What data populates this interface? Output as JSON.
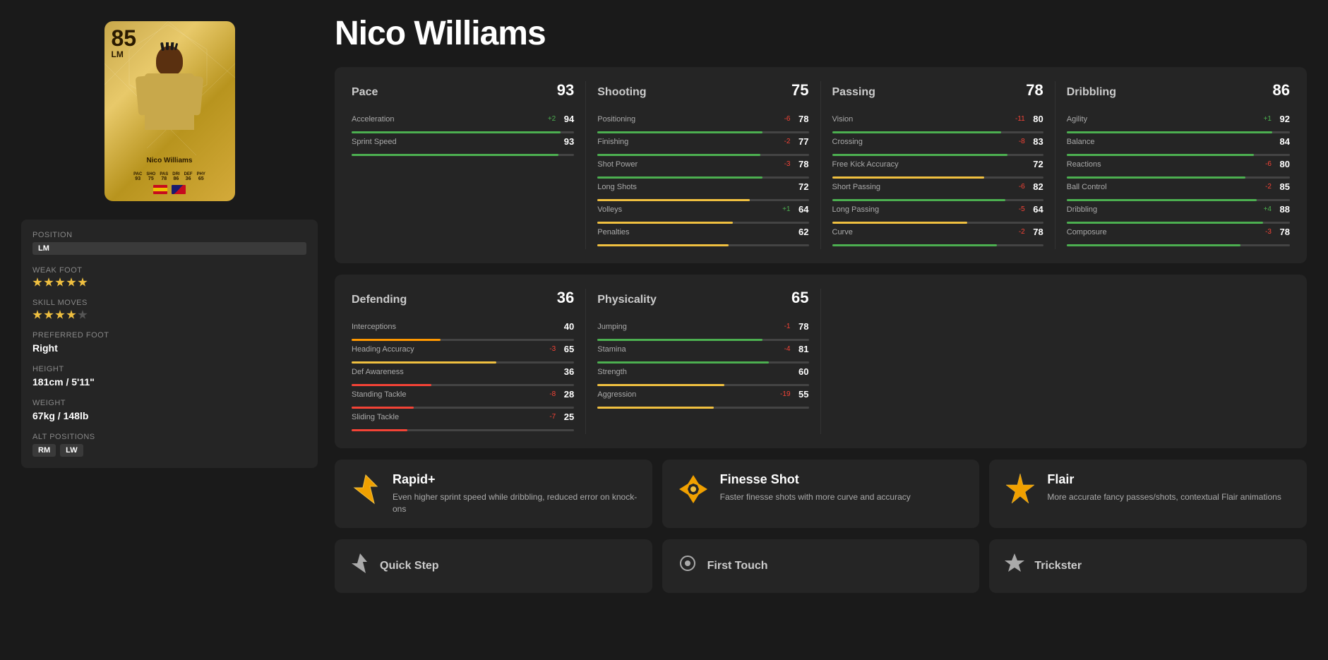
{
  "player": {
    "name": "Nico Williams",
    "rating": "85",
    "position": "LM",
    "card_stats": [
      {
        "label": "PAC",
        "value": "93"
      },
      {
        "label": "SHO",
        "value": "75"
      },
      {
        "label": "PAS",
        "value": "78"
      },
      {
        "label": "DRI",
        "value": "86"
      },
      {
        "label": "DEF",
        "value": "36"
      },
      {
        "label": "PHY",
        "value": "65"
      }
    ]
  },
  "info": {
    "position_label": "Position",
    "position": "LM",
    "weak_foot_label": "Weak Foot",
    "weak_foot_stars": 5,
    "skill_moves_label": "Skill Moves",
    "skill_moves_stars": 4,
    "preferred_foot_label": "Preferred Foot",
    "preferred_foot": "Right",
    "height_label": "Height",
    "height": "181cm / 5'11\"",
    "weight_label": "Weight",
    "weight": "67kg / 148lb",
    "alt_positions_label": "Alt Positions",
    "alt_positions": [
      "RM",
      "LW"
    ]
  },
  "page_title": "Nico Williams",
  "stats": {
    "pace": {
      "name": "Pace",
      "score": "93",
      "items": [
        {
          "name": "Acceleration",
          "modifier": "+2",
          "value": "94",
          "pct": 94
        },
        {
          "name": "Sprint Speed",
          "modifier": "",
          "value": "93",
          "pct": 93
        }
      ]
    },
    "shooting": {
      "name": "Shooting",
      "score": "75",
      "items": [
        {
          "name": "Positioning",
          "modifier": "-6",
          "value": "78",
          "pct": 78
        },
        {
          "name": "Finishing",
          "modifier": "-2",
          "value": "77",
          "pct": 77
        },
        {
          "name": "Shot Power",
          "modifier": "-3",
          "value": "78",
          "pct": 78
        },
        {
          "name": "Long Shots",
          "modifier": "",
          "value": "72",
          "pct": 72
        },
        {
          "name": "Volleys",
          "modifier": "+1",
          "value": "64",
          "pct": 64
        },
        {
          "name": "Penalties",
          "modifier": "",
          "value": "62",
          "pct": 62
        }
      ]
    },
    "passing": {
      "name": "Passing",
      "score": "78",
      "items": [
        {
          "name": "Vision",
          "modifier": "-11",
          "value": "80",
          "pct": 80
        },
        {
          "name": "Crossing",
          "modifier": "-8",
          "value": "83",
          "pct": 83
        },
        {
          "name": "Free Kick Accuracy",
          "modifier": "",
          "value": "72",
          "pct": 72
        },
        {
          "name": "Short Passing",
          "modifier": "-6",
          "value": "82",
          "pct": 82
        },
        {
          "name": "Long Passing",
          "modifier": "-5",
          "value": "64",
          "pct": 64
        },
        {
          "name": "Curve",
          "modifier": "-2",
          "value": "78",
          "pct": 78
        }
      ]
    },
    "dribbling": {
      "name": "Dribbling",
      "score": "86",
      "items": [
        {
          "name": "Agility",
          "modifier": "+1",
          "value": "92",
          "pct": 92
        },
        {
          "name": "Balance",
          "modifier": "",
          "value": "84",
          "pct": 84
        },
        {
          "name": "Reactions",
          "modifier": "-6",
          "value": "80",
          "pct": 80
        },
        {
          "name": "Ball Control",
          "modifier": "-2",
          "value": "85",
          "pct": 85
        },
        {
          "name": "Dribbling",
          "modifier": "+4",
          "value": "88",
          "pct": 88
        },
        {
          "name": "Composure",
          "modifier": "-3",
          "value": "78",
          "pct": 78
        }
      ]
    },
    "defending": {
      "name": "Defending",
      "score": "36",
      "items": [
        {
          "name": "Interceptions",
          "modifier": "",
          "value": "40",
          "pct": 40
        },
        {
          "name": "Heading Accuracy",
          "modifier": "-3",
          "value": "65",
          "pct": 65
        },
        {
          "name": "Def Awareness",
          "modifier": "",
          "value": "36",
          "pct": 36
        },
        {
          "name": "Standing Tackle",
          "modifier": "-8",
          "value": "28",
          "pct": 28
        },
        {
          "name": "Sliding Tackle",
          "modifier": "-7",
          "value": "25",
          "pct": 25
        }
      ]
    },
    "physicality": {
      "name": "Physicality",
      "score": "65",
      "items": [
        {
          "name": "Jumping",
          "modifier": "-1",
          "value": "78",
          "pct": 78
        },
        {
          "name": "Stamina",
          "modifier": "-4",
          "value": "81",
          "pct": 81
        },
        {
          "name": "Strength",
          "modifier": "",
          "value": "60",
          "pct": 60
        },
        {
          "name": "Aggression",
          "modifier": "-19",
          "value": "55",
          "pct": 55
        }
      ]
    }
  },
  "playstyles": [
    {
      "id": "rapid",
      "icon": "⚡",
      "name": "Rapid+",
      "desc": "Even higher sprint speed while dribbling, reduced error on knock-ons"
    },
    {
      "id": "finesse",
      "icon": "◇",
      "name": "Finesse Shot",
      "desc": "Faster finesse shots with more curve and accuracy"
    },
    {
      "id": "flair",
      "icon": "✦",
      "name": "Flair",
      "desc": "More accurate fancy passes/shots, contextual Flair animations"
    }
  ],
  "bottom_playstyles": [
    {
      "icon": "▲",
      "name": "Quick Step"
    },
    {
      "icon": "◉",
      "name": "First Touch"
    },
    {
      "icon": "✶",
      "name": "Trickster"
    }
  ]
}
